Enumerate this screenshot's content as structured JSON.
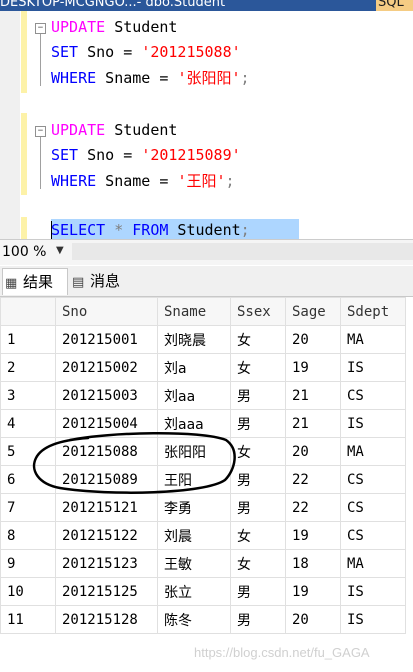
{
  "window": {
    "tab_title": "DESKTOP-MCGNGO...- dbo.Student",
    "tab_next": "SQL"
  },
  "editor": {
    "lines": [
      {
        "kw1": "UPDATE",
        "rest1": " Student"
      },
      {
        "kw1": "SET",
        "rest1": " Sno = ",
        "str": "'201215088'"
      },
      {
        "kw1": "WHERE",
        "rest1": " Sname = ",
        "str": "'张阳阳'",
        "tail": ";"
      },
      {
        "kw1": "UPDATE",
        "rest1": " Student"
      },
      {
        "kw1": "SET",
        "rest1": " Sno = ",
        "str": "'201215089'"
      },
      {
        "kw1": "WHERE",
        "rest1": " Sname = ",
        "str": "'王阳'",
        "tail": ";"
      },
      {
        "kw1": "SELECT",
        "star": " * ",
        "kw2": "FROM",
        "rest2": " Student",
        "tail": ";"
      }
    ]
  },
  "zoom": {
    "value": "100 %",
    "arrow": "▼"
  },
  "results_tabs": [
    {
      "label": "结果",
      "icon": "grid-icon"
    },
    {
      "label": "消息",
      "icon": "message-icon"
    }
  ],
  "grid": {
    "columns": [
      "Sno",
      "Sname",
      "Ssex",
      "Sage",
      "Sdept"
    ],
    "rows": [
      [
        "1",
        "201215001",
        "刘晓晨",
        "女",
        "20",
        "MA"
      ],
      [
        "2",
        "201215002",
        "刘a",
        "女",
        "19",
        "IS"
      ],
      [
        "3",
        "201215003",
        "刘aa",
        "男",
        "21",
        "CS"
      ],
      [
        "4",
        "201215004",
        "刘aaa",
        "男",
        "21",
        "IS"
      ],
      [
        "5",
        "201215088",
        "张阳阳",
        "女",
        "20",
        "MA"
      ],
      [
        "6",
        "201215089",
        "王阳",
        "男",
        "22",
        "CS"
      ],
      [
        "7",
        "201215121",
        "李勇",
        "男",
        "22",
        "CS"
      ],
      [
        "8",
        "201215122",
        "刘晨",
        "女",
        "19",
        "CS"
      ],
      [
        "9",
        "201215123",
        "王敏",
        "女",
        "18",
        "MA"
      ],
      [
        "10",
        "201215125",
        "张立",
        "男",
        "19",
        "IS"
      ],
      [
        "11",
        "201215128",
        "陈冬",
        "男",
        "20",
        "IS"
      ]
    ]
  },
  "watermark": "https://blog.csdn.net/fu_GAGA",
  "colors": {
    "keyword_pink": "#ff00ff",
    "keyword_blue": "#0000ff",
    "string_red": "#ff0000",
    "selection": "#add6ff",
    "title_bar": "#2b579a"
  }
}
